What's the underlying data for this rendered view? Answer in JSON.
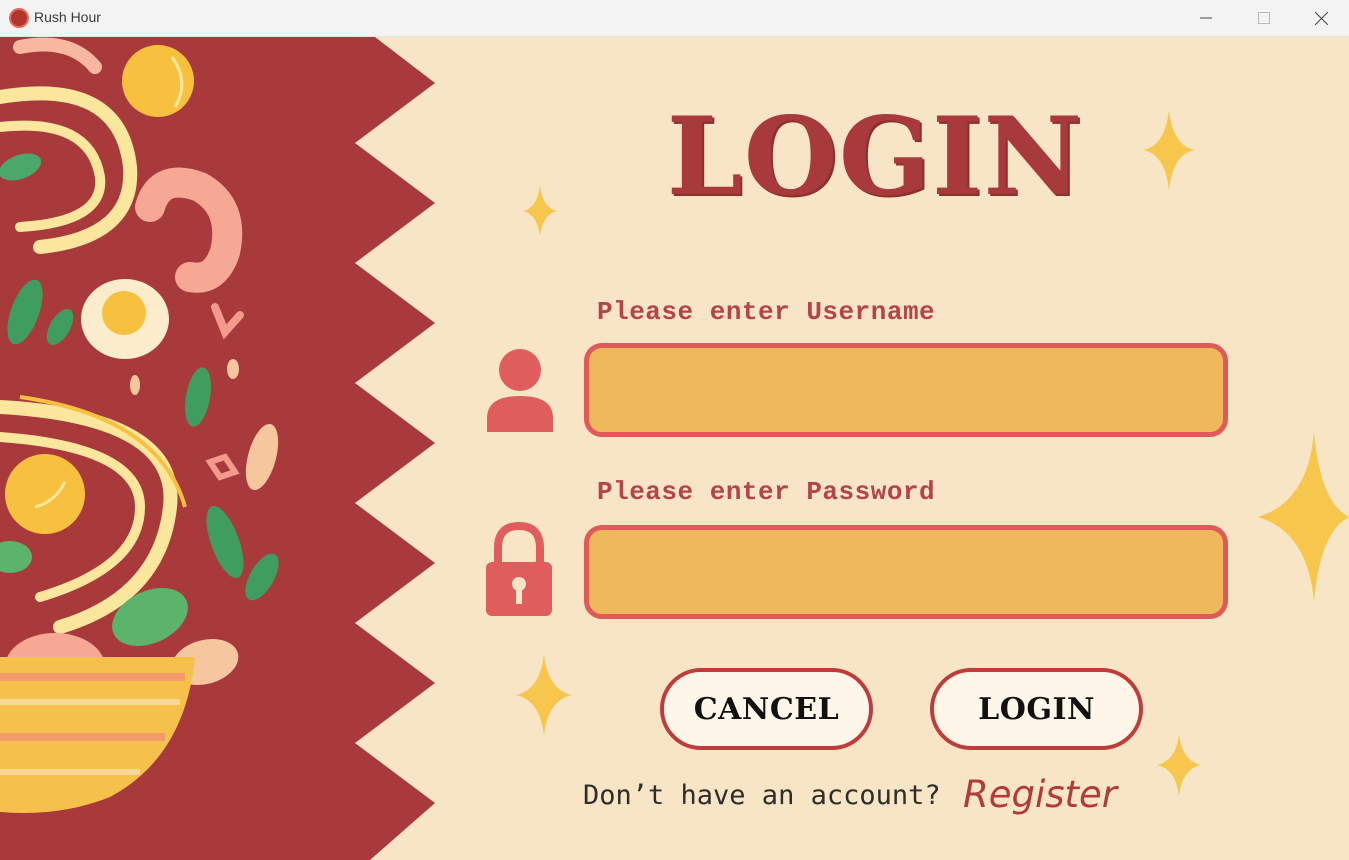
{
  "window": {
    "title": "Rush Hour",
    "controls": [
      "minimize",
      "maximize",
      "close"
    ]
  },
  "login_form": {
    "heading": "LOGIN",
    "username_label": "Please enter Username",
    "username_value": "",
    "password_label": "Please enter Password",
    "password_value": "",
    "cancel_label": "CANCEL",
    "login_label": "LOGIN",
    "no_account_text": "Don’t have an account?",
    "register_label": "Register"
  },
  "icons": {
    "app": "app-logo-icon",
    "user": "user-icon",
    "password": "lock-icon"
  },
  "colors": {
    "background": "#f7e5c6",
    "panel_red": "#a93a3c",
    "accent_red": "#df5a58",
    "input_fill": "#f0b85c",
    "button_fill": "#fef6e8",
    "sparkle": "#f6c64d"
  }
}
